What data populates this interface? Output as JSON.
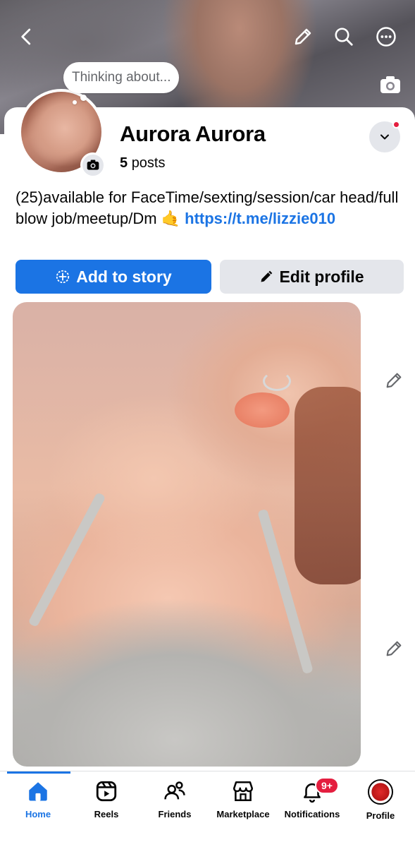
{
  "header": {
    "thought_bubble": "Thinking about..."
  },
  "profile": {
    "name": "Aurora Aurora",
    "posts_count": "5",
    "posts_label": "posts",
    "bio_text": "(25)available for FaceTime/sexting/session/car head/full blow job/meetup/Dm 🤙 ",
    "bio_link": "https://t.me/lizzie010"
  },
  "actions": {
    "add_story_label": "Add to story",
    "edit_profile_label": "Edit profile"
  },
  "tabbar": {
    "tabs": [
      {
        "label": "Home",
        "icon": "home-icon",
        "active": true
      },
      {
        "label": "Reels",
        "icon": "reels-icon",
        "active": false
      },
      {
        "label": "Friends",
        "icon": "friends-icon",
        "active": false
      },
      {
        "label": "Marketplace",
        "icon": "marketplace-icon",
        "active": false
      },
      {
        "label": "Notifications",
        "icon": "bell-icon",
        "active": false
      },
      {
        "label": "Profile",
        "icon": "profile-avatar",
        "active": false
      }
    ],
    "notifications_badge": "9+"
  },
  "colors": {
    "accent": "#1b74e4",
    "badge": "#e41e3f",
    "secondary_button": "#e4e6eb"
  }
}
